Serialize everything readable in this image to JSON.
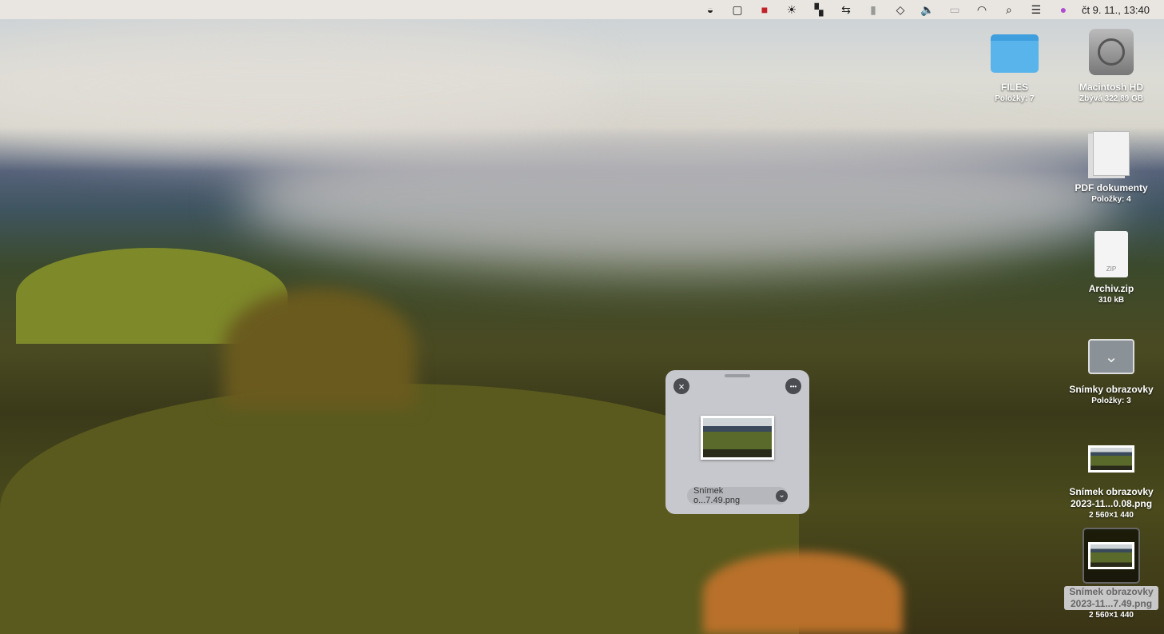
{
  "menubar": {
    "icons": [
      "dark-mode-icon",
      "app-icon",
      "red-app-icon",
      "brightness-icon",
      "layout-icon",
      "sync-icon",
      "battery-icon",
      "layers-icon",
      "volume-icon",
      "display-icon",
      "wifi-icon",
      "search-icon",
      "control-center-icon",
      "siri-icon"
    ],
    "clock": "čt 9. 11., 13:40"
  },
  "desktop": [
    {
      "label": "FILES",
      "sub": "Položky: 7",
      "icon": "folder-icon"
    },
    {
      "label": "Macintosh HD",
      "sub": "Zbývá 322,89 GB",
      "icon": "hard-drive-icon"
    },
    {
      "label": "PDF dokumenty",
      "sub": "Položky: 4",
      "icon": "pdf-stack-icon"
    },
    {
      "label": "Archiv.zip",
      "sub": "310 kB",
      "icon": "zip-icon",
      "badge": "ZIP"
    },
    {
      "label": "Snímky obrazovky",
      "sub": "Položky: 3",
      "icon": "screenshots-folder-icon"
    },
    {
      "label": "Snímek obrazovky",
      "label2": "2023-11...0.08.png",
      "sub": "2 560×1 440",
      "icon": "image-thumbnail-icon"
    },
    {
      "label": "Snímek obrazovky",
      "label2": "2023-11...7.49.png",
      "sub": "2 560×1 440",
      "icon": "image-thumbnail-icon"
    }
  ],
  "preview": {
    "filename": "Snímek o...7.49.png",
    "close": "×",
    "more": "•••",
    "chevron": "⌄"
  }
}
